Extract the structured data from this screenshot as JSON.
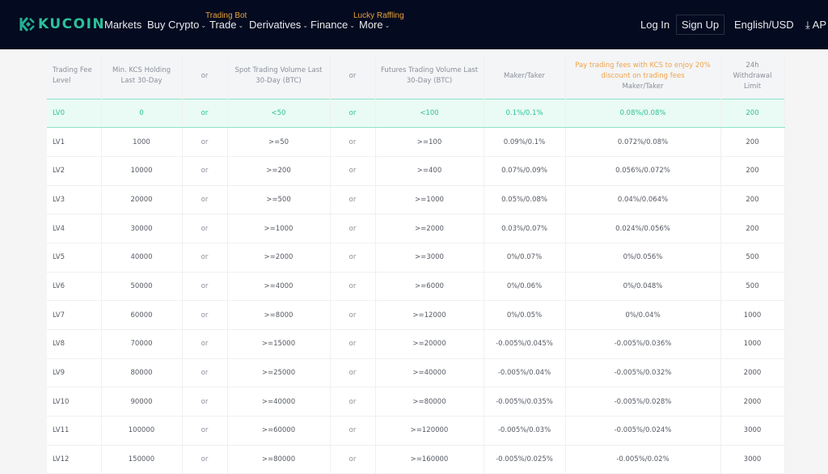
{
  "header": {
    "brand": "KUCOIN",
    "nav": [
      {
        "label": "Markets",
        "dropdown": false,
        "badge": null
      },
      {
        "label": "Buy Crypto",
        "dropdown": true,
        "badge": null
      },
      {
        "label": "Trade",
        "dropdown": true,
        "badge": "Trading Bot"
      },
      {
        "label": "Derivatives",
        "dropdown": true,
        "badge": null
      },
      {
        "label": "Finance",
        "dropdown": true,
        "badge": null
      },
      {
        "label": "More",
        "dropdown": true,
        "badge": "Lucky Raffling"
      }
    ],
    "login_label": "Log In",
    "signup_label": "Sign Up",
    "locale_label": "English/USD",
    "app_label": "AP",
    "colors": {
      "bg": "#040a1f",
      "brand": "#23af91",
      "badge": "#e8a33a"
    }
  },
  "fee_table": {
    "headers": {
      "level": "Trading Fee Level",
      "kcs": "Min. KCS Holding Last 30-Day",
      "or1": "or",
      "spot": "Spot Trading Volume Last 30-Day (BTC)",
      "or2": "or",
      "futures": "Futures Trading Volume Last 30-Day (BTC)",
      "maker_taker": "Maker/Taker",
      "kcs_promo": "Pay trading fees with KCS to enjoy 20% discount on trading fees",
      "kcs_maker_taker": "Maker/Taker",
      "withdrawal": "24h Withdrawal Limit"
    },
    "current_level": "LV0",
    "rows": [
      {
        "level": "LV0",
        "kcs": "0",
        "or1": "or",
        "spot": "<50",
        "or2": "or",
        "futures": "<100",
        "fee": "0.1%/0.1%",
        "kcs_fee": "0.08%/0.08%",
        "limit": "200"
      },
      {
        "level": "LV1",
        "kcs": "1000",
        "or1": "or",
        "spot": ">=50",
        "or2": "or",
        "futures": ">=100",
        "fee": "0.09%/0.1%",
        "kcs_fee": "0.072%/0.08%",
        "limit": "200"
      },
      {
        "level": "LV2",
        "kcs": "10000",
        "or1": "or",
        "spot": ">=200",
        "or2": "or",
        "futures": ">=400",
        "fee": "0.07%/0.09%",
        "kcs_fee": "0.056%/0.072%",
        "limit": "200"
      },
      {
        "level": "LV3",
        "kcs": "20000",
        "or1": "or",
        "spot": ">=500",
        "or2": "or",
        "futures": ">=1000",
        "fee": "0.05%/0.08%",
        "kcs_fee": "0.04%/0.064%",
        "limit": "200"
      },
      {
        "level": "LV4",
        "kcs": "30000",
        "or1": "or",
        "spot": ">=1000",
        "or2": "or",
        "futures": ">=2000",
        "fee": "0.03%/0.07%",
        "kcs_fee": "0.024%/0.056%",
        "limit": "200"
      },
      {
        "level": "LV5",
        "kcs": "40000",
        "or1": "or",
        "spot": ">=2000",
        "or2": "or",
        "futures": ">=3000",
        "fee": "0%/0.07%",
        "kcs_fee": "0%/0.056%",
        "limit": "500"
      },
      {
        "level": "LV6",
        "kcs": "50000",
        "or1": "or",
        "spot": ">=4000",
        "or2": "or",
        "futures": ">=6000",
        "fee": "0%/0.06%",
        "kcs_fee": "0%/0.048%",
        "limit": "500"
      },
      {
        "level": "LV7",
        "kcs": "60000",
        "or1": "or",
        "spot": ">=8000",
        "or2": "or",
        "futures": ">=12000",
        "fee": "0%/0.05%",
        "kcs_fee": "0%/0.04%",
        "limit": "1000"
      },
      {
        "level": "LV8",
        "kcs": "70000",
        "or1": "or",
        "spot": ">=15000",
        "or2": "or",
        "futures": ">=20000",
        "fee": "-0.005%/0.045%",
        "kcs_fee": "-0.005%/0.036%",
        "limit": "1000"
      },
      {
        "level": "LV9",
        "kcs": "80000",
        "or1": "or",
        "spot": ">=25000",
        "or2": "or",
        "futures": ">=40000",
        "fee": "-0.005%/0.04%",
        "kcs_fee": "-0.005%/0.032%",
        "limit": "2000"
      },
      {
        "level": "LV10",
        "kcs": "90000",
        "or1": "or",
        "spot": ">=40000",
        "or2": "or",
        "futures": ">=80000",
        "fee": "-0.005%/0.035%",
        "kcs_fee": "-0.005%/0.028%",
        "limit": "2000"
      },
      {
        "level": "LV11",
        "kcs": "100000",
        "or1": "or",
        "spot": ">=60000",
        "or2": "or",
        "futures": ">=120000",
        "fee": "-0.005%/0.03%",
        "kcs_fee": "-0.005%/0.024%",
        "limit": "3000"
      },
      {
        "level": "LV12",
        "kcs": "150000",
        "or1": "or",
        "spot": ">=80000",
        "or2": "or",
        "futures": ">=160000",
        "fee": "-0.005%/0.025%",
        "kcs_fee": "-0.005%/0.02%",
        "limit": "3000"
      }
    ]
  }
}
